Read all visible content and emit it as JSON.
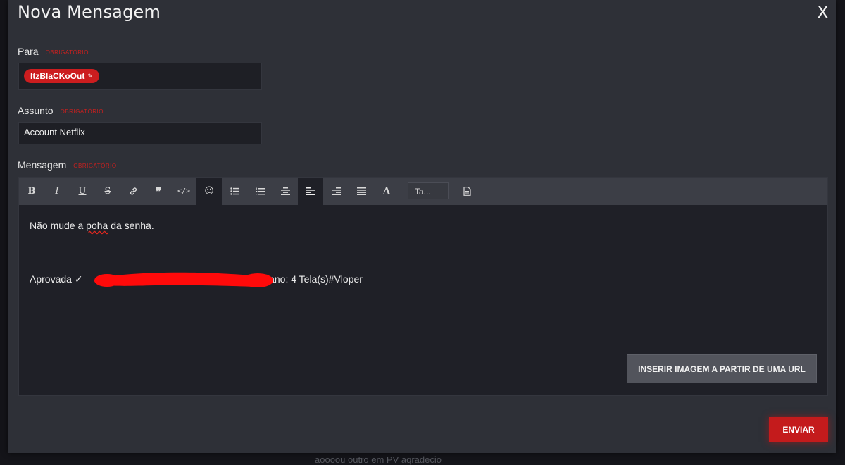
{
  "modal": {
    "title": "Nova Mensagem",
    "close": "X"
  },
  "fields": {
    "para": {
      "label": "Para",
      "required": "OBRIGATÓRIO",
      "recipient": "ItzBlaCKoOut"
    },
    "assunto": {
      "label": "Assunto",
      "required": "OBRIGATÓRIO",
      "value": "Account Netflix"
    },
    "mensagem": {
      "label": "Mensagem",
      "required": "OBRIGATÓRIO",
      "font_select": "Ta...",
      "line1_pre": "Não mude a ",
      "line1_word": "poha",
      "line1_post": " da senha.",
      "line2_pre": "Aprovada ✓",
      "line2_post": "lano: 4 Tela(s)#Vloper"
    }
  },
  "buttons": {
    "insert_image_url": "INSERIR IMAGEM A PARTIR DE UMA URL",
    "send": "ENVIAR"
  },
  "background_text": "aoooou outro em PV aqradecio",
  "colors": {
    "accent_red": "#c41b1c",
    "modal_bg": "#2e3037",
    "toolbar_bg": "#3c3e46",
    "editor_bg": "#1f2027"
  }
}
